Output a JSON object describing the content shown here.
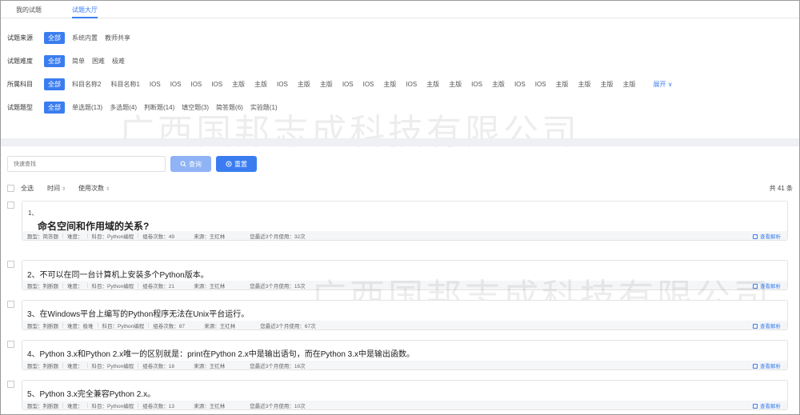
{
  "tabs": [
    {
      "label": "我的试题"
    },
    {
      "label": "试题大厅"
    }
  ],
  "filters": {
    "source": {
      "label": "试题来源",
      "options": [
        "全部",
        "系统内置",
        "教师共享"
      ]
    },
    "difficulty": {
      "label": "试题难度",
      "options": [
        "全部",
        "简单",
        "困难",
        "极难"
      ]
    },
    "subject": {
      "label": "所属科目",
      "options": [
        "全部",
        "科目名称2",
        "科目名称1",
        "IOS",
        "IOS",
        "IOS",
        "IOS",
        "主版",
        "主版",
        "IOS",
        "主版",
        "主版",
        "IOS",
        "IOS",
        "主版",
        "IOS",
        "主版",
        "主版",
        "IOS",
        "主版",
        "IOS",
        "IOS",
        "主版",
        "主版",
        "主版",
        "主版"
      ],
      "expand_label": "展开"
    },
    "type": {
      "label": "试题题型",
      "options": [
        "全部",
        "单选题(13)",
        "多选题(4)",
        "判断题(14)",
        "填空题(3)",
        "简答题(6)",
        "实验题(1)"
      ]
    }
  },
  "search": {
    "placeholder": "快速查找",
    "query_label": "查询",
    "reset_label": "重置"
  },
  "sortbar": {
    "select_all": "全选",
    "time": "时间",
    "usage": "使用次数",
    "total": "共 41 条"
  },
  "watermark": "广西国邦志成科技有限公司",
  "questions": [
    {
      "number": "1、",
      "title": "命名空间和作用域的关系?",
      "type": "题型：简答题",
      "difficulty": "难度：",
      "subject": "科目：Python编程",
      "count": "组卷次数：49",
      "source": "来源：王红林",
      "recent": "您最近3个月使用：32次",
      "analysis": "查看解析"
    },
    {
      "title": "2、不可以在同一台计算机上安装多个Python版本。",
      "type": "题型：判断题",
      "difficulty": "难度：",
      "subject": "科目：Python编程",
      "count": "组卷次数：21",
      "source": "来源：王红林",
      "recent": "您最近3个月使用：15次",
      "analysis": "查看解析"
    },
    {
      "title": "3、在Windows平台上编写的Python程序无法在Unix平台运行。",
      "type": "题型：判断题",
      "difficulty": "难度：极难",
      "subject": "科目：Python编程",
      "count": "组卷次数：87",
      "source": "来源：王红林",
      "recent": "您最近3个月使用：67次",
      "analysis": "查看解析"
    },
    {
      "title": "4、Python 3.x和Python 2.x唯一的区别就是：print在Python 2.x中是输出语句，而在Python 3.x中是输出函数。",
      "type": "题型：判断题",
      "difficulty": "难度：",
      "subject": "科目：Python编程",
      "count": "组卷次数：18",
      "source": "来源：王红林",
      "recent": "您最近3个月使用：16次",
      "analysis": "查看解析"
    },
    {
      "title": "5、Python 3.x完全兼容Python 2.x。",
      "type": "题型：判断题",
      "difficulty": "难度：",
      "subject": "科目：Python编程",
      "count": "组卷次数：13",
      "source": "来源：王红林",
      "recent": "您最近3个月使用：10次",
      "analysis": "查看解析"
    }
  ]
}
